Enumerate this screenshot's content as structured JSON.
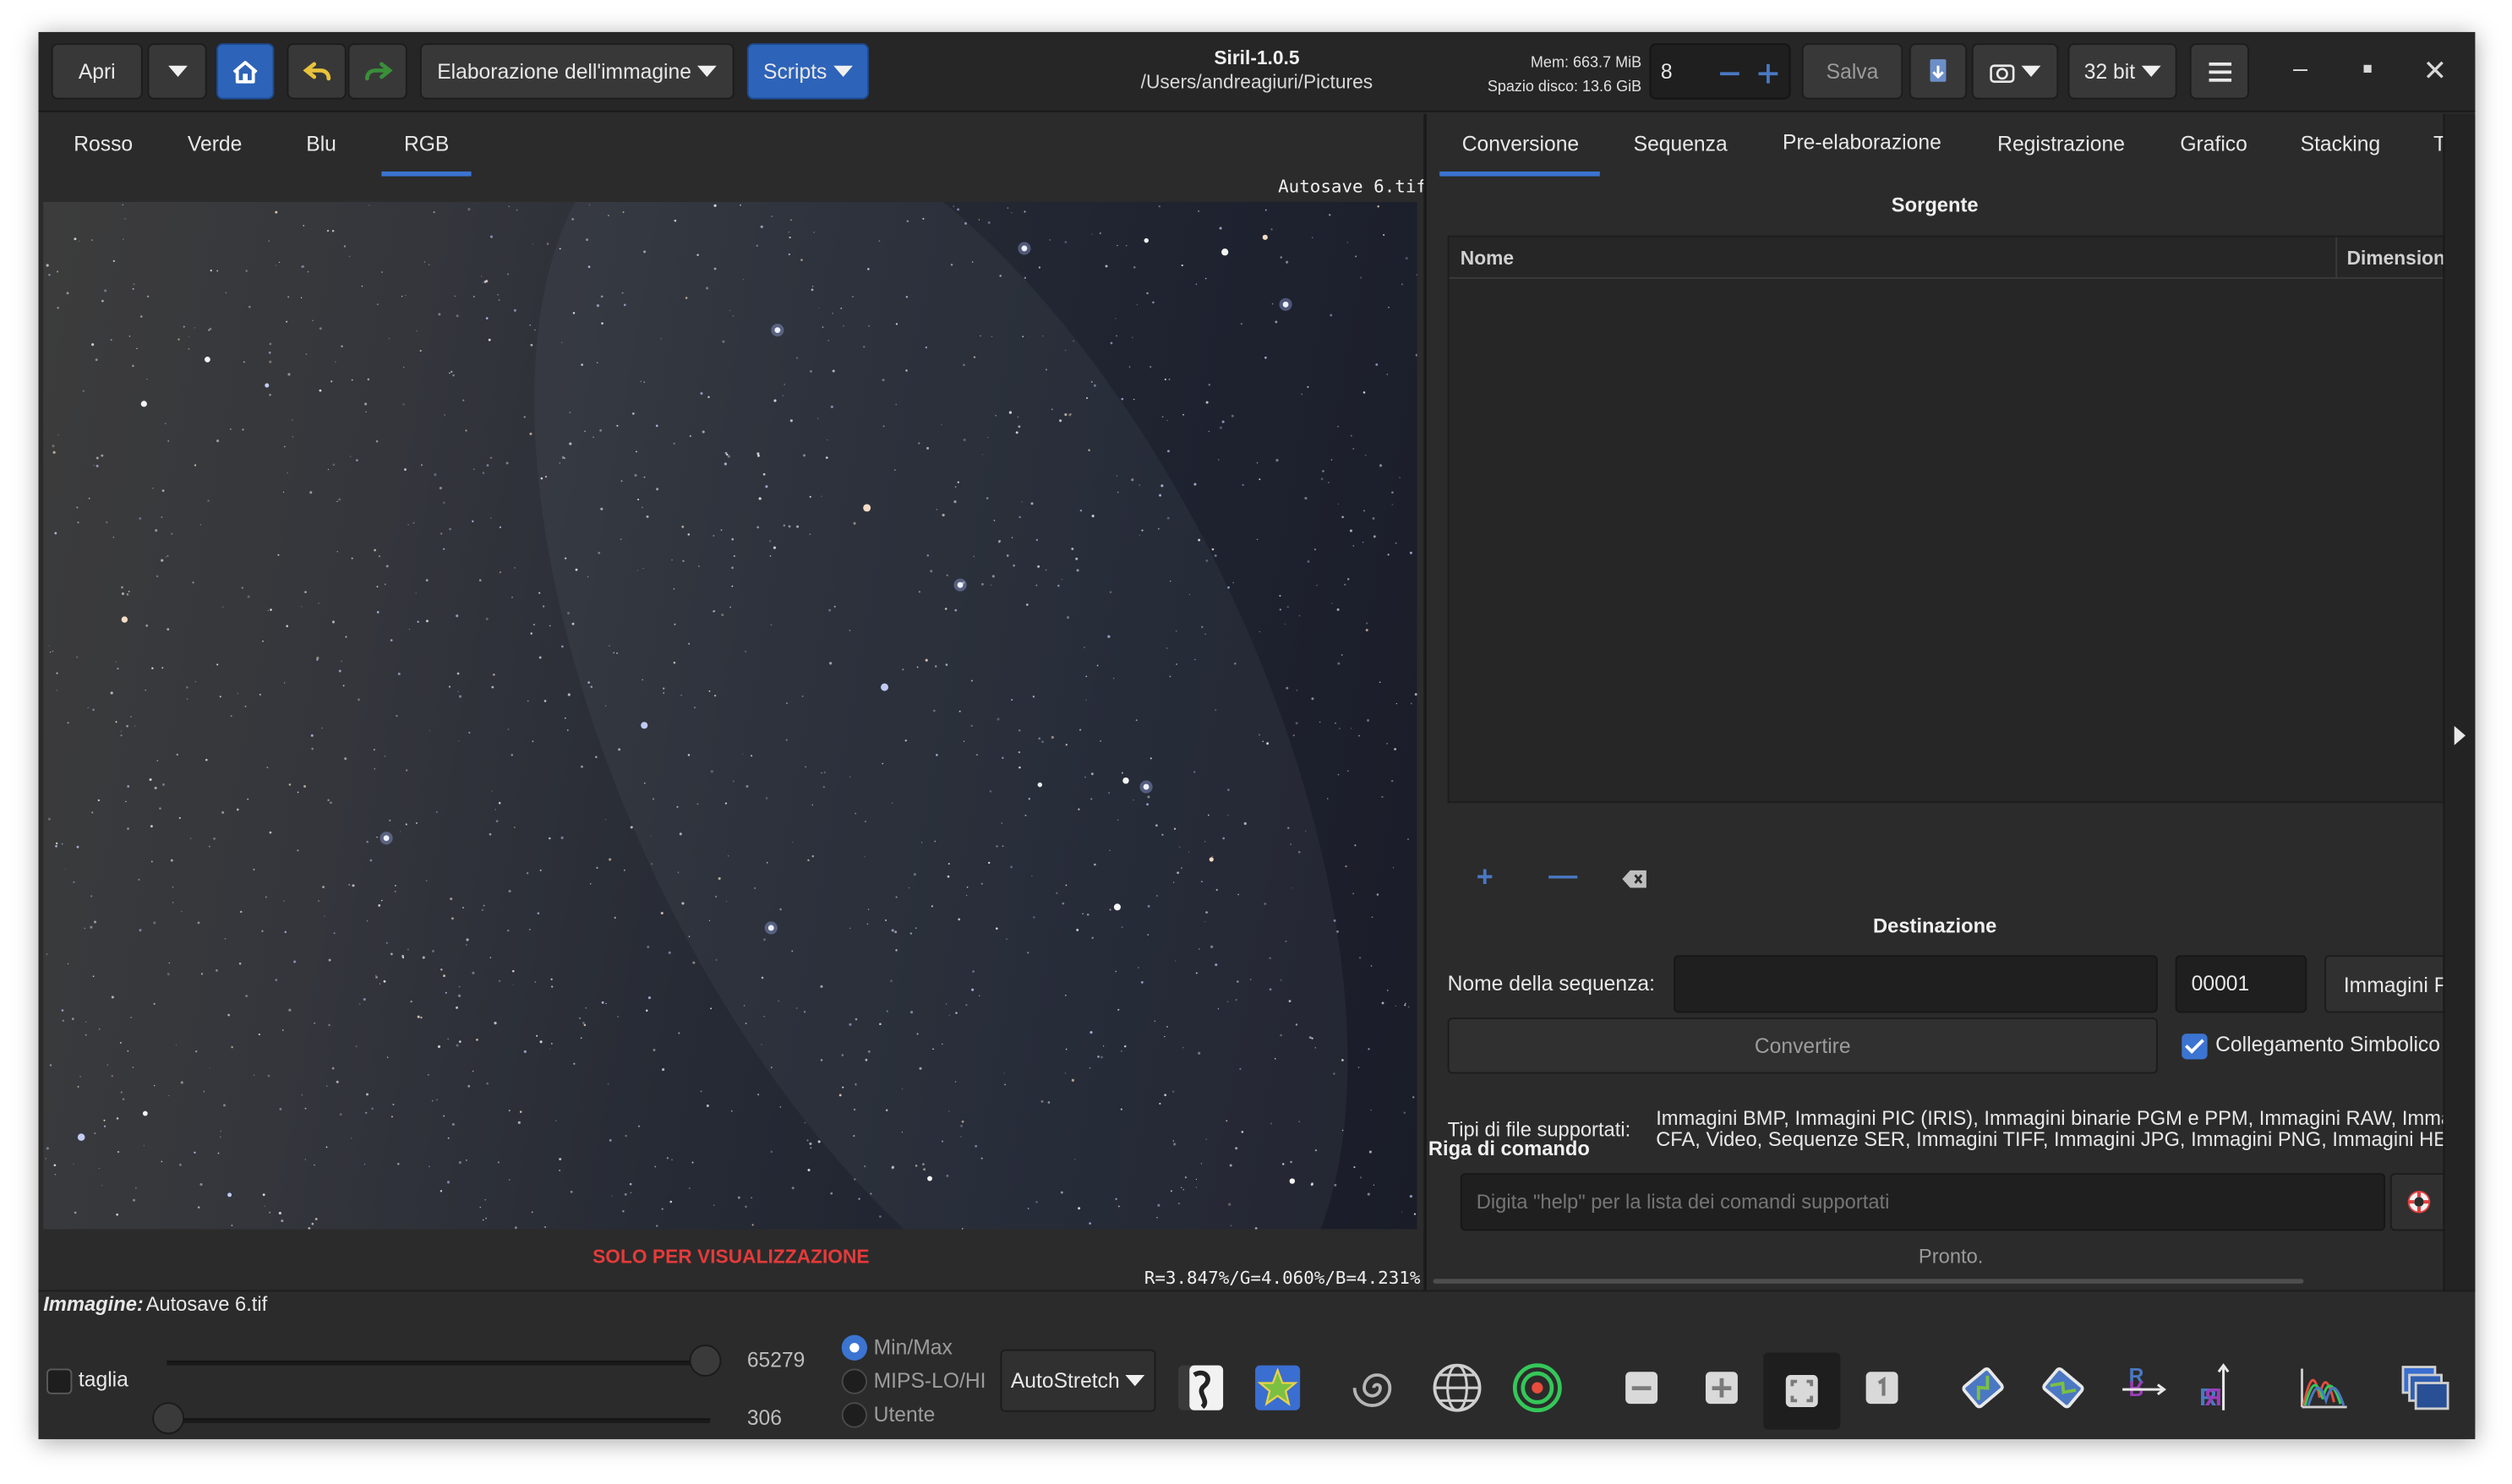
{
  "header": {
    "open_label": "Apri",
    "processing_label": "Elaborazione dell'immagine",
    "scripts_label": "Scripts",
    "app_title": "Siril-1.0.5",
    "path": "/Users/andreagiuri/Pictures",
    "mem": "Mem: 663.7 MiB",
    "disk": "Spazio disco: 13.6 GiB",
    "threads_value": "8",
    "save_label": "Salva",
    "bitdepth_label": "32 bit"
  },
  "channel_tabs": [
    "Rosso",
    "Verde",
    "Blu",
    "RGB"
  ],
  "image": {
    "filename": "Autosave 6.tif",
    "preview_notice": "SOLO PER VISUALIZZAZIONE",
    "rgb_values": "R=3.847%/G=4.060%/B=4.231%"
  },
  "right_tabs": [
    "Conversione",
    "Sequenza",
    "Pre-elaborazione",
    "Registrazione",
    "Grafico",
    "Stacking",
    "T"
  ],
  "conversion": {
    "source_title": "Sorgente",
    "col_name": "Nome",
    "col_dims": "Dimensioni",
    "destination_title": "Destinazione",
    "seq_name_label": "Nome della sequenza:",
    "seq_name_value": "",
    "start_index": "00001",
    "out_type": "Immagini FITS",
    "convert_button": "Convertire",
    "symlink_label": "Collegamento Simbolico",
    "symlink_checked": true,
    "file_types_label": "Tipi di file supportati:",
    "file_types_line1": "Immagini BMP, Immagini PIC (IRIS), Immagini binarie PGM e PPM, Immagini RAW, Immagini",
    "file_types_line2": "CFA, Video, Sequenze SER, Immagini TIFF, Immagini JPG, Immagini PNG, Immagini HEIF"
  },
  "command": {
    "title": "Riga di comando",
    "placeholder": "Digita \"help\" per la lista dei comandi supportati",
    "status": "Pronto."
  },
  "bottom": {
    "image_label": "Immagine:",
    "image_name": "Autosave 6.tif",
    "crop_label": "taglia",
    "high_value": "65279",
    "low_value": "306",
    "mode_minmax": "Min/Max",
    "mode_mips": "MIPS-LO/HI",
    "mode_user": "Utente",
    "display_mode": "AutoStretch"
  },
  "colors": {
    "accent": "#3b74d1",
    "warning": "#e53a3a",
    "background": "#2b2b2b"
  }
}
